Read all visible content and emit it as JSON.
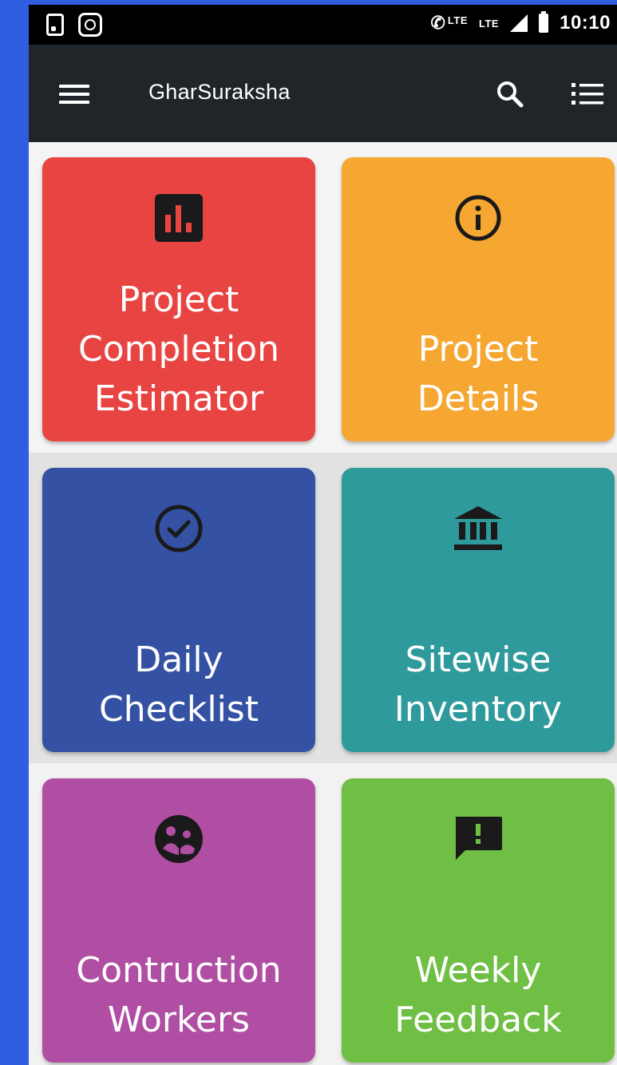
{
  "status_bar": {
    "network_label": "LTE",
    "network_label_2": "LTE",
    "time": "10:10"
  },
  "toolbar": {
    "title": "GharSuraksha",
    "menu_icon": "hamburger-menu-icon",
    "search_icon": "search-icon",
    "list_icon": "list-view-icon"
  },
  "tiles": [
    {
      "label_lines": [
        "Project",
        "Completion",
        "Estimator"
      ],
      "icon": "bar-chart-icon",
      "color": "#e84442"
    },
    {
      "label_lines": [
        "Project",
        "Details"
      ],
      "icon": "info-icon",
      "color": "#f5a731"
    },
    {
      "label_lines": [
        "Daily",
        "Checklist"
      ],
      "icon": "check-circle-icon",
      "color": "#3451a4"
    },
    {
      "label_lines": [
        "Sitewise",
        "Inventory"
      ],
      "icon": "bank-icon",
      "color": "#2e9a9b"
    },
    {
      "label_lines": [
        "Contruction",
        "Workers"
      ],
      "icon": "people-icon",
      "color": "#b04ea4"
    },
    {
      "label_lines": [
        "Weekly",
        "Feedback"
      ],
      "icon": "feedback-icon",
      "color": "#6fbf44"
    }
  ]
}
